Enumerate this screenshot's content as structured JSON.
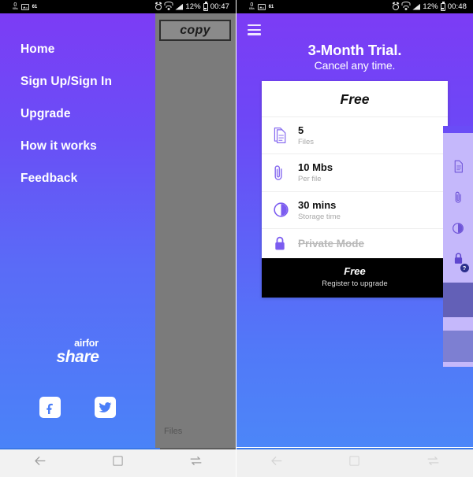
{
  "status_bar": {
    "data_rate_value": "0",
    "data_rate_unit": "KB/s",
    "image_icon": "image-icon",
    "badge": "61",
    "alarm_icon": "alarm-icon",
    "wifi_icon": "wifi-icon",
    "signal_icon": "signal-icon",
    "battery_pct": "12%",
    "battery_icon": "battery-icon",
    "time_left": "00:47",
    "time_right": "00:48"
  },
  "left_screen": {
    "drawer": {
      "menu_items": [
        {
          "label": "Home"
        },
        {
          "label": "Sign Up/Sign In"
        },
        {
          "label": "Upgrade"
        },
        {
          "label": "How it works"
        },
        {
          "label": "Feedback"
        }
      ],
      "brand_top": "airfor",
      "brand_bottom": "share",
      "social": [
        {
          "name": "facebook-icon"
        },
        {
          "name": "twitter-icon"
        }
      ]
    },
    "dimmed_panel": {
      "copy_button": "copy",
      "files_label": "Files"
    }
  },
  "right_screen": {
    "menu_icon": "hamburger-icon",
    "hero_title": "3-Month Trial.",
    "hero_subtitle": "Cancel any time.",
    "plan_card": {
      "title": "Free",
      "features": [
        {
          "icon": "document-icon",
          "value": "5",
          "label": "Files",
          "disabled": false
        },
        {
          "icon": "paperclip-icon",
          "value": "10 Mbs",
          "label": "Per file",
          "disabled": false
        },
        {
          "icon": "clock-icon",
          "value": "30 mins",
          "label": "Storage time",
          "disabled": false
        },
        {
          "icon": "lock-icon",
          "value": "Private Mode",
          "label": "",
          "disabled": true
        }
      ],
      "footer_title": "Free",
      "footer_subtitle": "Register to upgrade"
    },
    "peek_panel": {
      "icons": [
        "document-icon",
        "paperclip-icon",
        "clock-icon",
        "lock-help-icon"
      ],
      "help_badge": "?"
    }
  },
  "nav_bar": {
    "back": "back-icon",
    "home": "home-icon",
    "recents": "recents-icon"
  },
  "colors": {
    "purple_top": "#7c3cf5",
    "blue_bottom": "#4c86f8",
    "accent_purple": "#7b5cf0",
    "nav_blue": "#3b78e7",
    "black": "#000000"
  }
}
